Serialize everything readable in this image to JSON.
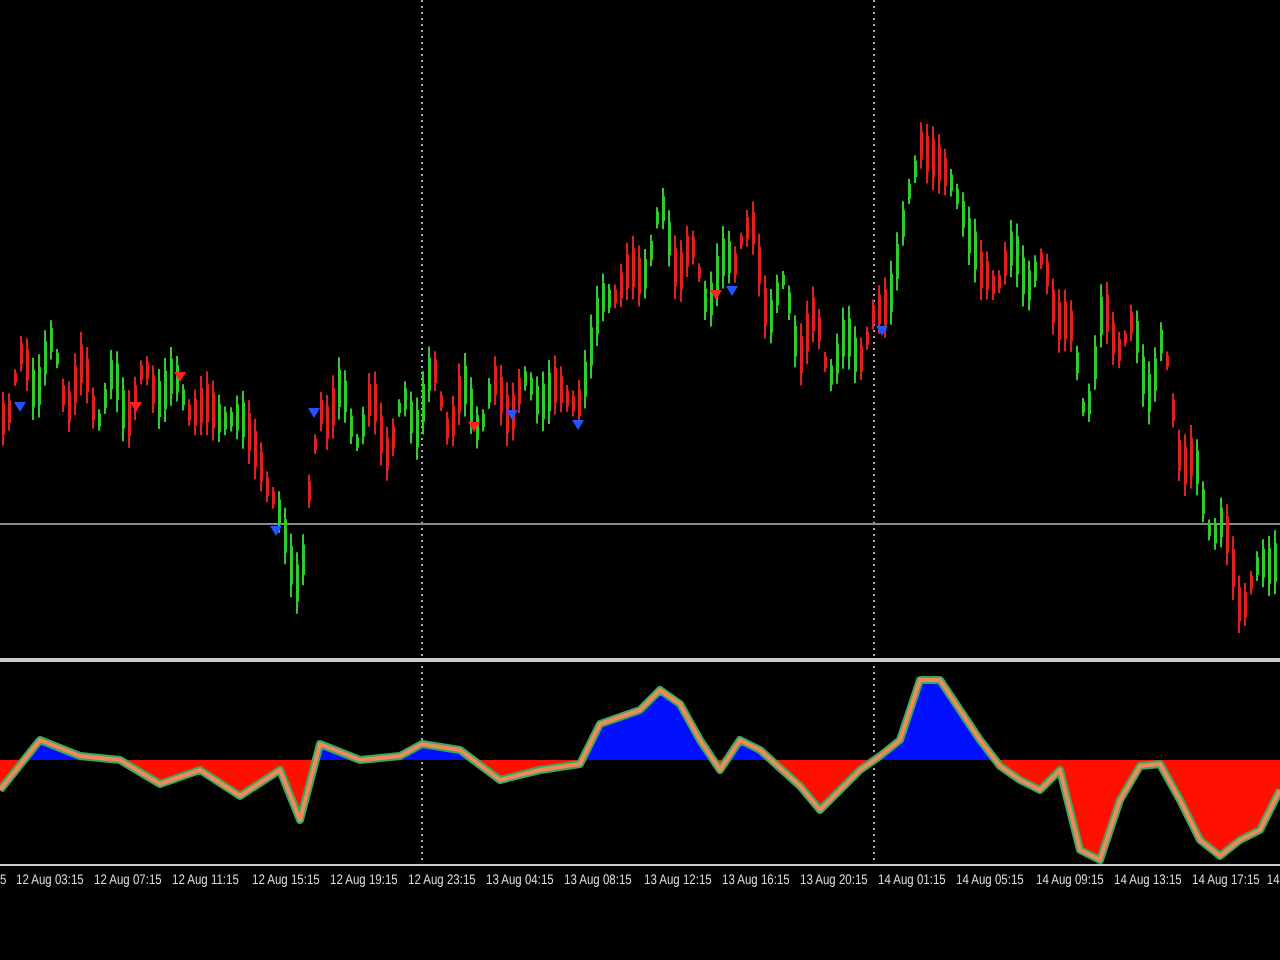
{
  "time_axis": {
    "labels": [
      "5",
      "12 Aug 03:15",
      "12 Aug 07:15",
      "12 Aug 11:15",
      "12 Aug 15:15",
      "12 Aug 19:15",
      "12 Aug 23:15",
      "13 Aug 04:15",
      "13 Aug 08:15",
      "13 Aug 12:15",
      "13 Aug 16:15",
      "13 Aug 20:15",
      "14 Aug 01:15",
      "14 Aug 05:15",
      "14 Aug 09:15",
      "14 Aug 13:15",
      "14 Aug 17:15",
      "14"
    ]
  }
}
